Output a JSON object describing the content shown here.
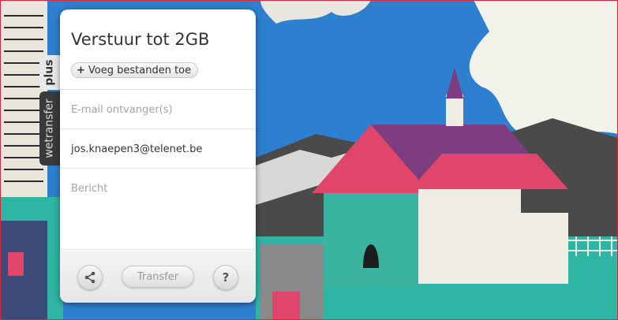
{
  "tabs": {
    "plus": "plus",
    "brand": "wetransfer"
  },
  "form": {
    "title": "Verstuur tot 2GB",
    "add_files_label": "Voeg bestanden toe",
    "add_files_icon": "plus-icon",
    "email_placeholder": "E-mail ontvanger(s)",
    "from_value": "jos.knaepen3@telenet.be",
    "message_placeholder": "Bericht"
  },
  "footer": {
    "share_icon": "share-icon",
    "transfer_label": "Transfer",
    "help_label": "?"
  },
  "colors": {
    "frame": "#d9263b",
    "sky": "#2f7fd0",
    "grass": "#2fb5a3",
    "roof": "#e2456a",
    "panel": "#ffffff"
  }
}
